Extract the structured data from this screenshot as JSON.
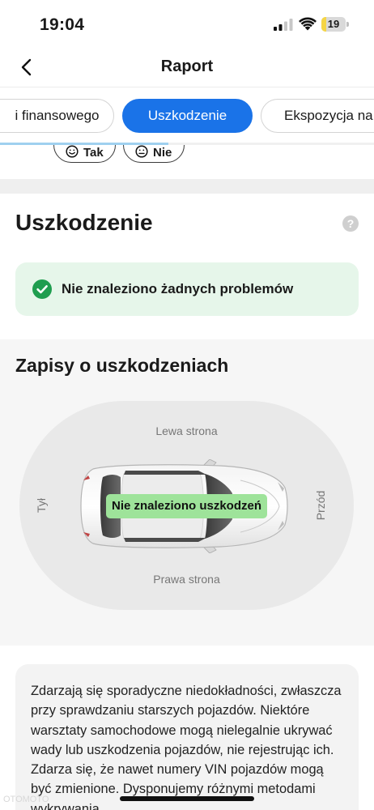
{
  "status_bar": {
    "time": "19:04",
    "battery_level": "19",
    "battery_fraction": 0.19,
    "battery_color": "#f5d546",
    "icons": [
      "signal-icon",
      "wifi-icon",
      "battery-icon"
    ]
  },
  "nav": {
    "title": "Raport",
    "back_icon": "chevron-left-icon"
  },
  "tabs": [
    {
      "label": "i finansowego",
      "active": false
    },
    {
      "label": "Uszkodzenie",
      "active": true
    },
    {
      "label": "Ekspozycja na",
      "active": false
    }
  ],
  "tab_scroll_fraction": 0.45,
  "answers": {
    "yes_label": "Tak",
    "no_label": "Nie",
    "yes_icon": "smile-icon",
    "no_icon": "meh-icon"
  },
  "damage": {
    "title": "Uszkodzenie",
    "help_icon_label": "?",
    "status_text": "Nie znaleziono żadnych problemów",
    "status_icon": "check-circle-icon"
  },
  "records": {
    "title": "Zapisy o uszkodzeniach",
    "left_side": "Lewa strona",
    "right_side": "Prawa strona",
    "rear": "Tył",
    "front": "Przód",
    "no_damage": "Nie znaleziono uszkodzeń"
  },
  "info": {
    "text": "Zdarzają się sporadyczne niedokładności, zwłaszcza przy sprawdzaniu starszych pojazdów. Niektóre warsztaty samochodowe mogą nielegalnie ukrywać wady lub uszkodzenia pojazdów, nie rejestrując ich. Zdarza się, że nawet numery VIN pojazdów mogą być zmienione. Dysponujemy różnymi metodami wykrywania"
  },
  "colors": {
    "accent": "#1a73e8",
    "success": "#1f9d4f",
    "success_bg": "#e6f6ea",
    "no_damage_pill": "#9ee39a"
  },
  "watermark": "OTOMOTO"
}
